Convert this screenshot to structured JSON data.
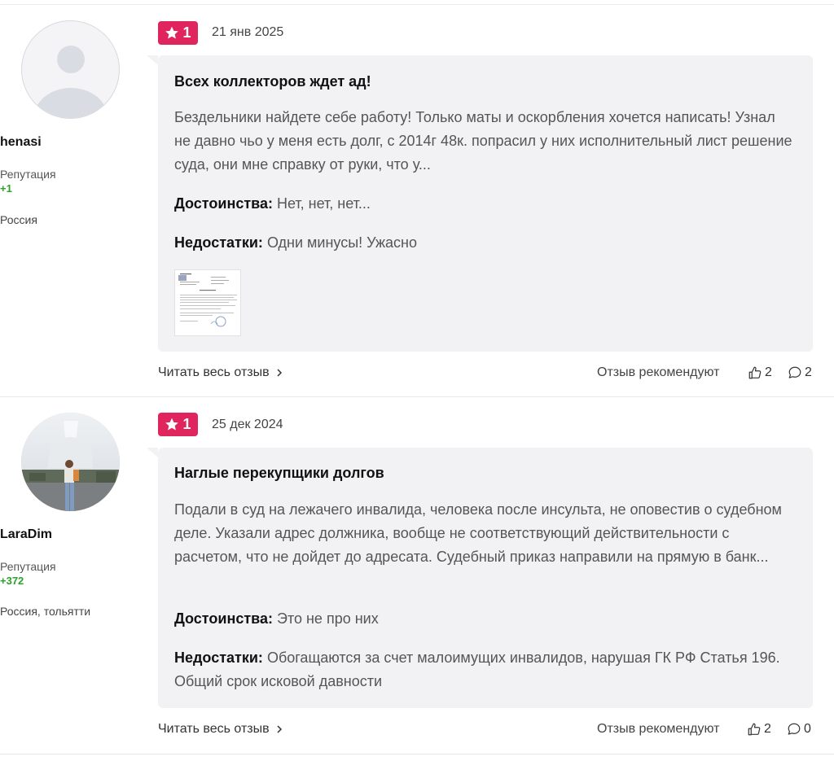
{
  "reviews": [
    {
      "author": {
        "name": "henasi",
        "reputation_label": "Репутация",
        "reputation_value": "+1",
        "location": "Россия",
        "avatar": "default-avatar-icon"
      },
      "rating": "1",
      "date": "21 янв 2025",
      "title": "Всех коллекторов ждет ад!",
      "text": "Бездельники найдете себе работу! Только маты и оскорбления хочется написать! Узнал не давно чьо у меня есть долг, с 2014г 48к. попрасил у них исполнительный лист решение суда, они мне справку от руки, что у...",
      "pros_label": "Достоинства:",
      "pros": "Нет, нет, нет...",
      "cons_label": "Недостатки:",
      "cons": "Одни минусы! Ужасно",
      "has_attachment": true,
      "read_more": "Читать весь отзыв",
      "recommend_label": "Отзыв рекомендуют",
      "likes": "2",
      "comments": "2"
    },
    {
      "author": {
        "name": "LaraDim",
        "reputation_label": "Репутация",
        "reputation_value": "+372",
        "location": "Россия, тольятти",
        "avatar": "user-photo"
      },
      "rating": "1",
      "date": "25 дек 2024",
      "title": "Наглые перекупщики долгов",
      "text": "Подали в суд на лежачего инвалида, человека после инсульта, не оповестив о судебном деле. Указали адрес должника, вообще не соответствующий действительности с расчетом, что не дойдет до адресата. Судебный приказ направили на прямую в банк...",
      "pros_label": "Достоинства:",
      "pros": "Это не про них",
      "cons_label": "Недостатки:",
      "cons": "Обогащаются за счет малоимущих инвалидов, нарушая ГК РФ Статья 196. Общий срок исковой давности",
      "has_attachment": false,
      "read_more": "Читать весь отзыв",
      "recommend_label": "Отзыв рекомендуют",
      "likes": "2",
      "comments": "0"
    }
  ],
  "colors": {
    "badge": "#e0245e",
    "card_bg": "#f2f2f4",
    "reputation": "#2aa32a"
  },
  "icons": {
    "rating": "star-icon",
    "read_more": "chevron-right-icon",
    "like": "thumbs-up-icon",
    "comment": "speech-bubble-icon"
  }
}
